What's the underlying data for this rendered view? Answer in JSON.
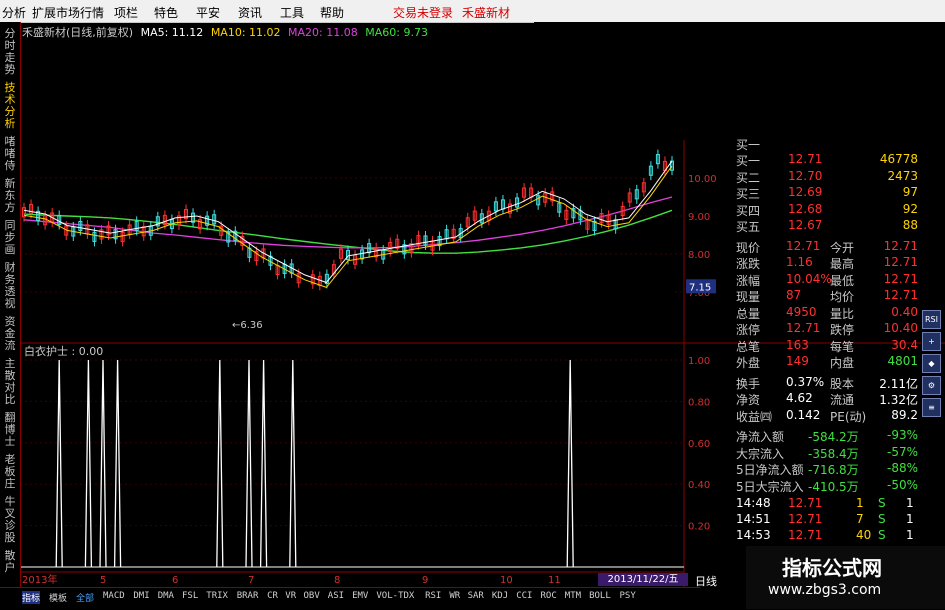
{
  "menu": {
    "items": [
      "分析",
      "扩展市场行情",
      "项栏",
      "特色",
      "平安",
      "资讯",
      "工具",
      "帮助"
    ],
    "status_login": "交易未登录",
    "stock_name": "禾盛新材"
  },
  "left_tabs": [
    "分时走势",
    "技术分析",
    "啫啫侍",
    "新东方",
    "同步画",
    "财务透视",
    "资金流",
    "主散对比",
    "翻博士",
    "老板庄",
    "牛叉诊股",
    "散户"
  ],
  "chart_title": {
    "name": "禾盛新材(日线,前复权)",
    "ma5": "MA5: 11.12",
    "ma10": "MA10: 11.02",
    "ma20": "MA20: 11.08",
    "ma60": "MA60: 9.73"
  },
  "colors": {
    "ma5": "#ffffff",
    "ma10": "#ffd400",
    "ma20": "#e040e0",
    "ma60": "#40e040",
    "up": "#ff3030",
    "down": "#40e0e0"
  },
  "chart_data": {
    "type": "line",
    "price_axis": {
      "ticks": [
        "10.00",
        "9.00",
        "8.00",
        "7.00"
      ],
      "min": 6.0,
      "max": 11.0
    },
    "current_price_marker": "7.15",
    "low_annotation": "←6.36",
    "ma20": [
      8.9,
      8.85,
      8.8,
      8.75,
      8.7,
      8.62,
      8.55,
      8.5,
      8.44,
      8.38,
      8.32,
      8.27,
      8.23,
      8.2,
      8.18,
      8.16,
      8.16,
      8.17,
      8.2,
      8.25,
      8.3,
      8.36,
      8.44,
      8.52,
      8.62,
      8.74,
      8.88,
      9.02,
      9.18,
      9.35,
      9.5
    ],
    "ma60": [
      9.05,
      9.02,
      9.0,
      8.98,
      8.95,
      8.9,
      8.84,
      8.78,
      8.7,
      8.62,
      8.55,
      8.48,
      8.4,
      8.33,
      8.26,
      8.2,
      8.14,
      8.08,
      8.04,
      8.02,
      8.02,
      8.05,
      8.1,
      8.16,
      8.24,
      8.34,
      8.46,
      8.6,
      8.76,
      8.95,
      9.15
    ],
    "indicator": {
      "name": "白衣护士 : 0.00",
      "ticks": [
        "1.00",
        "0.80",
        "0.60",
        "0.40",
        "0.20"
      ],
      "spike_x_index": [
        2,
        4,
        5,
        6,
        13,
        15,
        16,
        18,
        37
      ]
    },
    "x_labels": [
      "2013年",
      "5",
      "6",
      "7",
      "8",
      "9",
      "10",
      "11"
    ],
    "selected_date": "2013/11/22/五"
  },
  "quote": {
    "rows": [
      {
        "l": "买一",
        "v": "12.71",
        "r": "46778"
      },
      {
        "l": "买二",
        "v": "12.70",
        "r": "2473"
      },
      {
        "l": "买三",
        "v": "12.69",
        "r": "97"
      },
      {
        "l": "买四",
        "v": "12.68",
        "r": "92"
      },
      {
        "l": "买五",
        "v": "12.67",
        "r": "88"
      },
      {
        "l": "现价",
        "v": "12.71",
        "l2": "今开",
        "r": "12.71"
      },
      {
        "l": "涨跌",
        "v": "1.16",
        "l2": "最高",
        "r": "12.71"
      },
      {
        "l": "涨幅",
        "v": "10.04%",
        "l2": "最低",
        "r": "12.71"
      },
      {
        "l": "现量",
        "v": "87",
        "l2": "均价",
        "r": "12.71"
      },
      {
        "l": "总量",
        "v": "4950",
        "l2": "量比",
        "r": "0.40"
      },
      {
        "l": "涨停",
        "v": "12.71",
        "l2": "跌停",
        "r": "10.40"
      },
      {
        "l": "总笔",
        "v": "163",
        "l2": "每笔",
        "r": "30.4"
      },
      {
        "l": "外盘",
        "v": "149",
        "l2": "内盘",
        "r": "4801"
      },
      {
        "l": "换手",
        "v": "0.37%",
        "l2": "股本",
        "r": "2.11亿"
      },
      {
        "l": "净资",
        "v": "4.62",
        "l2": "流通",
        "r": "1.32亿"
      },
      {
        "l": "收益㈣",
        "v": "0.142",
        "l2": "PE(动)",
        "r": "89.2"
      },
      {
        "l": "净流入额",
        "v": "-584.2万",
        "r": "-93%"
      },
      {
        "l": "大宗流入",
        "v": "-358.4万",
        "r": "-57%"
      },
      {
        "l": "5日净流入额",
        "v": "-716.8万",
        "r": "-88%"
      },
      {
        "l": "5日大宗流入",
        "v": "-410.5万",
        "r": "-50%"
      }
    ],
    "ticks": [
      {
        "t": "14:48",
        "p": "12.71",
        "v": "1",
        "s": "S",
        "n": "1"
      },
      {
        "t": "14:51",
        "p": "12.71",
        "v": "7",
        "s": "S",
        "n": "1"
      },
      {
        "t": "14:53",
        "p": "12.71",
        "v": "40",
        "s": "S",
        "n": "1"
      }
    ],
    "top_partial": "买一"
  },
  "right_icons": [
    "RSI",
    "+",
    "◆",
    "⚙",
    "≡"
  ],
  "bottom_tabs": [
    "指标",
    "模板",
    "全部",
    "MACD",
    "DMI",
    "DMA",
    "FSL",
    "TRIX",
    "BRAR",
    "CR",
    "VR",
    "OBV",
    "ASI",
    "EMV",
    "VOL-TDX",
    "RSI",
    "WR",
    "SAR",
    "KDJ",
    "CCI",
    "ROC",
    "MTM",
    "BOLL",
    "PSY"
  ],
  "kline_label": "日线",
  "watermark": {
    "title": "指标公式网",
    "url": "www.zbgs3.com"
  }
}
